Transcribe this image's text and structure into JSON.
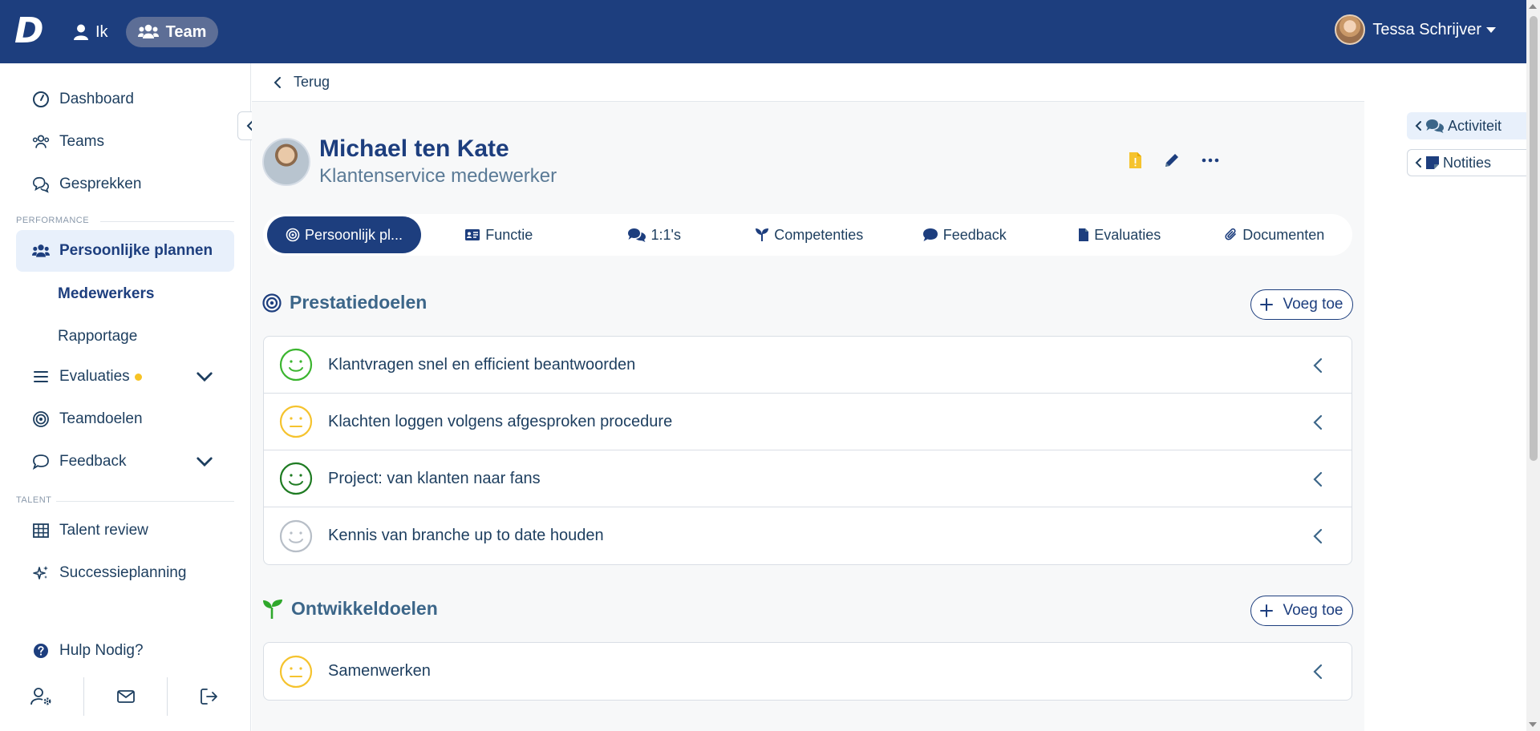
{
  "topbar": {
    "logo": "D",
    "nav_ik": "Ik",
    "nav_team": "Team",
    "user_name": "Tessa Schrijver"
  },
  "sidebar": {
    "dashboard": "Dashboard",
    "teams": "Teams",
    "gesprekken": "Gesprekken",
    "section_performance": "PERFORMANCE",
    "persoonlijke_plannen": "Persoonlijke plannen",
    "medewerkers": "Medewerkers",
    "rapportage": "Rapportage",
    "evaluaties": "Evaluaties",
    "teamdoelen": "Teamdoelen",
    "feedback": "Feedback",
    "section_talent": "TALENT",
    "talent_review": "Talent review",
    "successieplanning": "Successieplanning",
    "hulp": "Hulp Nodig?"
  },
  "main": {
    "back_label": "Terug",
    "profile": {
      "name": "Michael ten Kate",
      "role": "Klantenservice medewerker"
    },
    "tabs": [
      {
        "label": "Persoonlijk pl..."
      },
      {
        "label": "Functie"
      },
      {
        "label": "1:1's"
      },
      {
        "label": "Competenties"
      },
      {
        "label": "Feedback"
      },
      {
        "label": "Evaluaties"
      },
      {
        "label": "Documenten"
      }
    ],
    "prestatiedoelen": {
      "title": "Prestatiedoelen",
      "add_label": "Voeg toe",
      "goals": [
        {
          "text": "Klantvragen snel en efficient beantwoorden",
          "status": "happy",
          "color": "#3bb52f"
        },
        {
          "text": "Klachten loggen volgens afgesproken procedure",
          "status": "neutral",
          "color": "#f5c32e"
        },
        {
          "text": "Project: van klanten naar fans",
          "status": "happy",
          "color": "#1e7b22"
        },
        {
          "text": "Kennis van branche up to date houden",
          "status": "happy",
          "color": "#b7bec7"
        }
      ]
    },
    "ontwikkeldoelen": {
      "title": "Ontwikkeldoelen",
      "add_label": "Voeg toe",
      "goals": [
        {
          "text": "Samenwerken",
          "status": "neutral",
          "color": "#f5c32e"
        }
      ]
    }
  },
  "right_panel": {
    "activiteit": "Activiteit",
    "notities": "Notities"
  },
  "colors": {
    "primary": "#1d3e7e",
    "accent_yellow": "#f5c32e",
    "accent_green": "#3bb52f"
  }
}
